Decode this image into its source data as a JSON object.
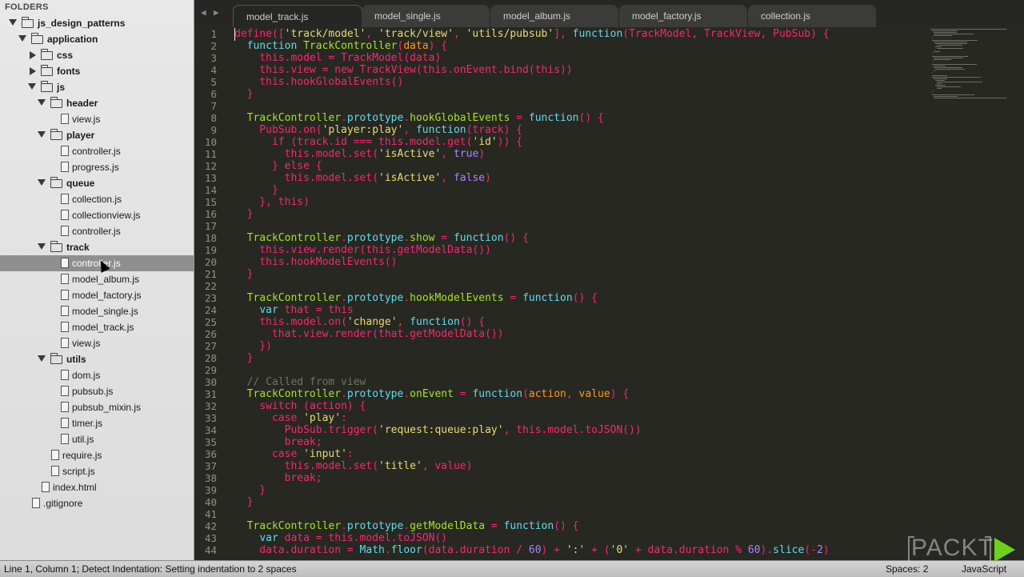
{
  "sidebar": {
    "title": "FOLDERS",
    "items": [
      {
        "label": "js_design_patterns",
        "type": "folder",
        "expanded": true,
        "level": 0,
        "bold": true
      },
      {
        "label": "application",
        "type": "folder",
        "expanded": true,
        "level": 1,
        "bold": true
      },
      {
        "label": "css",
        "type": "folder",
        "expanded": false,
        "level": 2,
        "bold": true
      },
      {
        "label": "fonts",
        "type": "folder",
        "expanded": false,
        "level": 2,
        "bold": true
      },
      {
        "label": "js",
        "type": "folder",
        "expanded": true,
        "level": 2,
        "bold": true
      },
      {
        "label": "header",
        "type": "folder",
        "expanded": true,
        "level": 3,
        "bold": true
      },
      {
        "label": "view.js",
        "type": "file",
        "level": 4
      },
      {
        "label": "player",
        "type": "folder",
        "expanded": true,
        "level": 3,
        "bold": true
      },
      {
        "label": "controller.js",
        "type": "file",
        "level": 4
      },
      {
        "label": "progress.js",
        "type": "file",
        "level": 4
      },
      {
        "label": "queue",
        "type": "folder",
        "expanded": true,
        "level": 3,
        "bold": true
      },
      {
        "label": "collection.js",
        "type": "file",
        "level": 4
      },
      {
        "label": "collectionview.js",
        "type": "file",
        "level": 4
      },
      {
        "label": "controller.js",
        "type": "file",
        "level": 4
      },
      {
        "label": "track",
        "type": "folder",
        "expanded": true,
        "level": 3,
        "bold": true
      },
      {
        "label": "controller.js",
        "type": "file",
        "level": 4,
        "selected": true
      },
      {
        "label": "model_album.js",
        "type": "file",
        "level": 4
      },
      {
        "label": "model_factory.js",
        "type": "file",
        "level": 4
      },
      {
        "label": "model_single.js",
        "type": "file",
        "level": 4
      },
      {
        "label": "model_track.js",
        "type": "file",
        "level": 4
      },
      {
        "label": "view.js",
        "type": "file",
        "level": 4
      },
      {
        "label": "utils",
        "type": "folder",
        "expanded": true,
        "level": 3,
        "bold": true
      },
      {
        "label": "dom.js",
        "type": "file",
        "level": 4
      },
      {
        "label": "pubsub.js",
        "type": "file",
        "level": 4
      },
      {
        "label": "pubsub_mixin.js",
        "type": "file",
        "level": 4
      },
      {
        "label": "timer.js",
        "type": "file",
        "level": 4
      },
      {
        "label": "util.js",
        "type": "file",
        "level": 4
      },
      {
        "label": "require.js",
        "type": "file",
        "level": 3
      },
      {
        "label": "script.js",
        "type": "file",
        "level": 3
      },
      {
        "label": "index.html",
        "type": "file",
        "level": 2
      },
      {
        "label": ".gitignore",
        "type": "file",
        "level": 1
      }
    ]
  },
  "tabs": {
    "prev_icon": "triangle-left",
    "next_icon": "triangle-right",
    "items": [
      {
        "label": "model_track.js"
      },
      {
        "label": "model_single.js"
      },
      {
        "label": "model_album.js"
      },
      {
        "label": "model_factory.js"
      },
      {
        "label": "collection.js"
      }
    ]
  },
  "editor": {
    "language": "JavaScript",
    "lines": [
      [
        [
          "t",
          "define(["
        ],
        [
          "s",
          "'track/model'"
        ],
        [
          "t",
          ", "
        ],
        [
          "s",
          "'track/view'"
        ],
        [
          "t",
          ", "
        ],
        [
          "s",
          "'utils/pubsub'"
        ],
        [
          "t",
          "], "
        ],
        [
          "v",
          "function"
        ],
        [
          "t",
          "(TrackModel, TrackView, PubSub) {"
        ]
      ],
      [
        [
          "t",
          "  "
        ],
        [
          "v",
          "function"
        ],
        [
          "t",
          " "
        ],
        [
          "f",
          "TrackController"
        ],
        [
          "t",
          "("
        ],
        [
          "b",
          "data"
        ],
        [
          "t",
          ") {"
        ]
      ],
      [
        [
          "t",
          "    "
        ],
        [
          "k",
          "this"
        ],
        [
          "t",
          ".model = TrackModel(data)"
        ]
      ],
      [
        [
          "t",
          "    "
        ],
        [
          "k",
          "this"
        ],
        [
          "t",
          ".view = "
        ],
        [
          "k",
          "new"
        ],
        [
          "t",
          " TrackView("
        ],
        [
          "k",
          "this"
        ],
        [
          "t",
          ".onEvent.bind("
        ],
        [
          "k",
          "this"
        ],
        [
          "t",
          "))"
        ]
      ],
      [
        [
          "t",
          "    "
        ],
        [
          "k",
          "this"
        ],
        [
          "t",
          ".hookGlobalEvents()"
        ]
      ],
      [
        [
          "t",
          "  }"
        ]
      ],
      [
        [
          "t",
          ""
        ]
      ],
      [
        [
          "t",
          "  "
        ],
        [
          "f",
          "TrackController"
        ],
        [
          "t",
          "."
        ],
        [
          "v",
          "prototype"
        ],
        [
          "t",
          "."
        ],
        [
          "f",
          "hookGlobalEvents"
        ],
        [
          "t",
          " = "
        ],
        [
          "v",
          "function"
        ],
        [
          "t",
          "() {"
        ]
      ],
      [
        [
          "t",
          "    PubSub.on("
        ],
        [
          "s",
          "'player:play'"
        ],
        [
          "t",
          ", "
        ],
        [
          "v",
          "function"
        ],
        [
          "t",
          "(track) {"
        ]
      ],
      [
        [
          "t",
          "      "
        ],
        [
          "k",
          "if"
        ],
        [
          "t",
          " (track.id "
        ],
        [
          "k",
          "==="
        ],
        [
          "t",
          " "
        ],
        [
          "k",
          "this"
        ],
        [
          "t",
          ".model.get("
        ],
        [
          "s",
          "'id'"
        ],
        [
          "t",
          ")) {"
        ]
      ],
      [
        [
          "t",
          "        "
        ],
        [
          "k",
          "this"
        ],
        [
          "t",
          ".model.set("
        ],
        [
          "s",
          "'isActive'"
        ],
        [
          "t",
          ", "
        ],
        [
          "n",
          "true"
        ],
        [
          "t",
          ")"
        ]
      ],
      [
        [
          "t",
          "      } "
        ],
        [
          "k",
          "else"
        ],
        [
          "t",
          " {"
        ]
      ],
      [
        [
          "t",
          "        "
        ],
        [
          "k",
          "this"
        ],
        [
          "t",
          ".model.set("
        ],
        [
          "s",
          "'isActive'"
        ],
        [
          "t",
          ", "
        ],
        [
          "n",
          "false"
        ],
        [
          "t",
          ")"
        ]
      ],
      [
        [
          "t",
          "      }"
        ]
      ],
      [
        [
          "t",
          "    }, "
        ],
        [
          "k",
          "this"
        ],
        [
          "t",
          ")"
        ]
      ],
      [
        [
          "t",
          "  }"
        ]
      ],
      [
        [
          "t",
          ""
        ]
      ],
      [
        [
          "t",
          "  "
        ],
        [
          "f",
          "TrackController"
        ],
        [
          "t",
          "."
        ],
        [
          "v",
          "prototype"
        ],
        [
          "t",
          "."
        ],
        [
          "f",
          "show"
        ],
        [
          "t",
          " = "
        ],
        [
          "v",
          "function"
        ],
        [
          "t",
          "() {"
        ]
      ],
      [
        [
          "t",
          "    "
        ],
        [
          "k",
          "this"
        ],
        [
          "t",
          ".view.render("
        ],
        [
          "k",
          "this"
        ],
        [
          "t",
          ".getModelData())"
        ]
      ],
      [
        [
          "t",
          "    "
        ],
        [
          "k",
          "this"
        ],
        [
          "t",
          ".hookModelEvents()"
        ]
      ],
      [
        [
          "t",
          "  }"
        ]
      ],
      [
        [
          "t",
          ""
        ]
      ],
      [
        [
          "t",
          "  "
        ],
        [
          "f",
          "TrackController"
        ],
        [
          "t",
          "."
        ],
        [
          "v",
          "prototype"
        ],
        [
          "t",
          "."
        ],
        [
          "f",
          "hookModelEvents"
        ],
        [
          "t",
          " = "
        ],
        [
          "v",
          "function"
        ],
        [
          "t",
          "() {"
        ]
      ],
      [
        [
          "t",
          "    "
        ],
        [
          "v",
          "var"
        ],
        [
          "t",
          " that "
        ],
        [
          "k",
          "="
        ],
        [
          "t",
          " "
        ],
        [
          "k",
          "this"
        ]
      ],
      [
        [
          "t",
          "    "
        ],
        [
          "k",
          "this"
        ],
        [
          "t",
          ".model.on("
        ],
        [
          "s",
          "'change'"
        ],
        [
          "t",
          ", "
        ],
        [
          "v",
          "function"
        ],
        [
          "t",
          "() {"
        ]
      ],
      [
        [
          "t",
          "      that.view.render(that.getModelData())"
        ]
      ],
      [
        [
          "t",
          "    })"
        ]
      ],
      [
        [
          "t",
          "  }"
        ]
      ],
      [
        [
          "t",
          ""
        ]
      ],
      [
        [
          "c",
          "  // Called from view"
        ]
      ],
      [
        [
          "t",
          "  "
        ],
        [
          "f",
          "TrackController"
        ],
        [
          "t",
          "."
        ],
        [
          "v",
          "prototype"
        ],
        [
          "t",
          "."
        ],
        [
          "f",
          "onEvent"
        ],
        [
          "t",
          " = "
        ],
        [
          "v",
          "function"
        ],
        [
          "t",
          "("
        ],
        [
          "b",
          "action"
        ],
        [
          "t",
          ", "
        ],
        [
          "b",
          "value"
        ],
        [
          "t",
          ") {"
        ]
      ],
      [
        [
          "t",
          "    "
        ],
        [
          "k",
          "switch"
        ],
        [
          "t",
          " (action) {"
        ]
      ],
      [
        [
          "t",
          "      "
        ],
        [
          "k",
          "case"
        ],
        [
          "t",
          " "
        ],
        [
          "s",
          "'play'"
        ],
        [
          "t",
          ":"
        ]
      ],
      [
        [
          "t",
          "        PubSub.trigger("
        ],
        [
          "s",
          "'request:queue:play'"
        ],
        [
          "t",
          ", "
        ],
        [
          "k",
          "this"
        ],
        [
          "t",
          ".model.toJSON())"
        ]
      ],
      [
        [
          "t",
          "        "
        ],
        [
          "k",
          "break"
        ],
        [
          "t",
          ";"
        ]
      ],
      [
        [
          "t",
          "      "
        ],
        [
          "k",
          "case"
        ],
        [
          "t",
          " "
        ],
        [
          "s",
          "'input'"
        ],
        [
          "t",
          ":"
        ]
      ],
      [
        [
          "t",
          "        "
        ],
        [
          "k",
          "this"
        ],
        [
          "t",
          ".model.set("
        ],
        [
          "s",
          "'title'"
        ],
        [
          "t",
          ", value)"
        ]
      ],
      [
        [
          "t",
          "        "
        ],
        [
          "k",
          "break"
        ],
        [
          "t",
          ";"
        ]
      ],
      [
        [
          "t",
          "    }"
        ]
      ],
      [
        [
          "t",
          "  }"
        ]
      ],
      [
        [
          "t",
          ""
        ]
      ],
      [
        [
          "t",
          "  "
        ],
        [
          "f",
          "TrackController"
        ],
        [
          "t",
          "."
        ],
        [
          "v",
          "prototype"
        ],
        [
          "t",
          "."
        ],
        [
          "f",
          "getModelData"
        ],
        [
          "t",
          " = "
        ],
        [
          "v",
          "function"
        ],
        [
          "t",
          "() {"
        ]
      ],
      [
        [
          "t",
          "    "
        ],
        [
          "v",
          "var"
        ],
        [
          "t",
          " data "
        ],
        [
          "k",
          "="
        ],
        [
          "t",
          " "
        ],
        [
          "k",
          "this"
        ],
        [
          "t",
          ".model.toJSON()"
        ]
      ],
      [
        [
          "t",
          "    data.duration "
        ],
        [
          "k",
          "="
        ],
        [
          "t",
          " "
        ],
        [
          "v",
          "Math"
        ],
        [
          "t",
          "."
        ],
        [
          "v",
          "floor"
        ],
        [
          "t",
          "(data.duration "
        ],
        [
          "k",
          "/"
        ],
        [
          "t",
          " "
        ],
        [
          "n",
          "60"
        ],
        [
          "t",
          ") "
        ],
        [
          "k",
          "+"
        ],
        [
          "t",
          " "
        ],
        [
          "s",
          "':'"
        ],
        [
          "t",
          " "
        ],
        [
          "k",
          "+"
        ],
        [
          "t",
          " ("
        ],
        [
          "s",
          "'0'"
        ],
        [
          "t",
          " "
        ],
        [
          "k",
          "+"
        ],
        [
          "t",
          " data.duration "
        ],
        [
          "k",
          "%"
        ],
        [
          "t",
          " "
        ],
        [
          "n",
          "60"
        ],
        [
          "t",
          ")."
        ],
        [
          "v",
          "slice"
        ],
        [
          "t",
          "("
        ],
        [
          "k",
          "-"
        ],
        [
          "n",
          "2"
        ],
        [
          "t",
          ")"
        ]
      ]
    ]
  },
  "statusbar": {
    "message": "Line 1, Column 1; Detect Indentation: Setting indentation to 2 spaces",
    "spaces": "Spaces: 2",
    "syntax": "JavaScript"
  },
  "logo": {
    "text": "PACKT",
    "play_color": "#6ecf1e"
  }
}
